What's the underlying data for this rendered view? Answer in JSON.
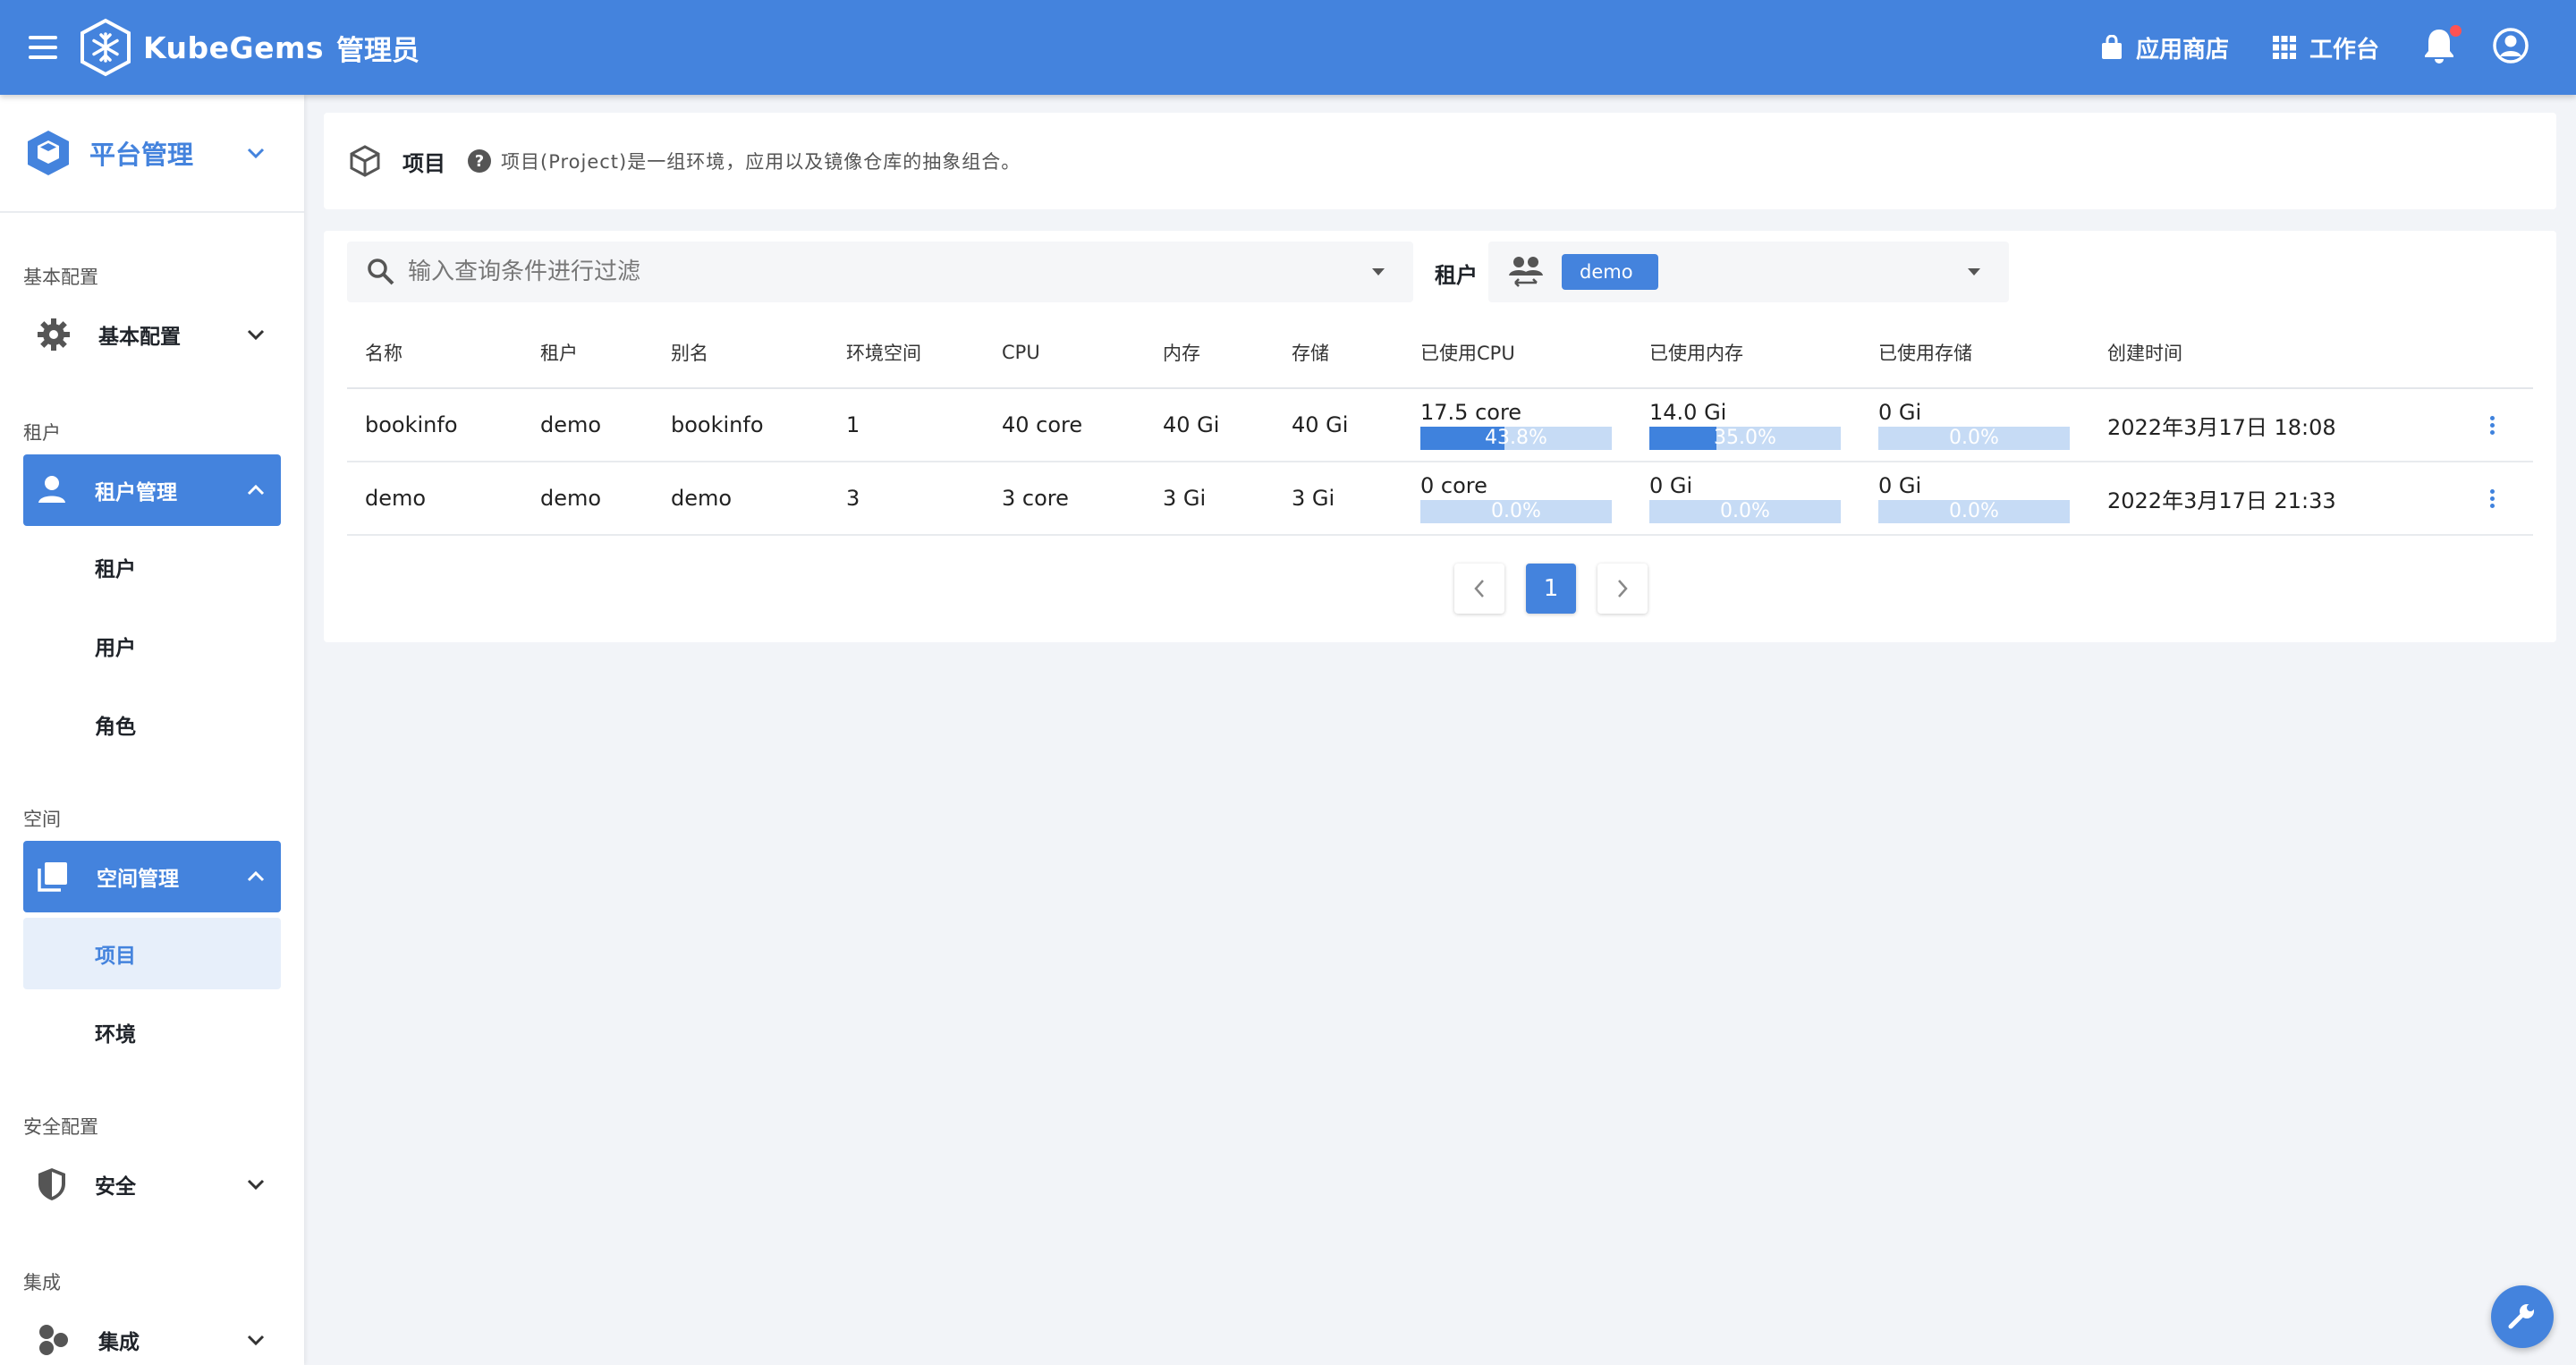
{
  "app": {
    "brand": "KubeGems",
    "role": "管理员"
  },
  "topbar": {
    "app_store": "应用商店",
    "workbench": "工作台"
  },
  "sidebar": {
    "platform": "平台管理",
    "sections": {
      "basic": {
        "title": "基本配置",
        "group": "基本配置"
      },
      "tenant": {
        "title": "租户",
        "group": "租户管理",
        "items": [
          "租户",
          "用户",
          "角色"
        ]
      },
      "space": {
        "title": "空间",
        "group": "空间管理",
        "items": [
          "项目",
          "环境"
        ]
      },
      "security": {
        "title": "安全配置",
        "group": "安全"
      },
      "integration": {
        "title": "集成",
        "group": "集成"
      }
    }
  },
  "header": {
    "title": "项目",
    "description": "项目(Project)是一组环境，应用以及镜像仓库的抽象组合。"
  },
  "filter": {
    "placeholder": "输入查询条件进行过滤",
    "tenant_label": "租户",
    "tenant_value": "demo"
  },
  "table": {
    "headers": [
      "名称",
      "租户",
      "别名",
      "环境空间",
      "CPU",
      "内存",
      "存储",
      "已使用CPU",
      "已使用内存",
      "已使用存储",
      "创建时间"
    ],
    "rows": [
      {
        "name": "bookinfo",
        "tenant": "demo",
        "alias": "bookinfo",
        "envs": "1",
        "cpu": "40 core",
        "memory": "40 Gi",
        "storage": "40 Gi",
        "used_cpu": "17.5 core",
        "used_cpu_pct": "43.8%",
        "used_cpu_frac": 0.438,
        "used_mem": "14.0 Gi",
        "used_mem_pct": "35.0%",
        "used_mem_frac": 0.35,
        "used_storage": "0 Gi",
        "used_storage_pct": "0.0%",
        "used_storage_frac": 0.0,
        "created": "2022年3月17日 18:08"
      },
      {
        "name": "demo",
        "tenant": "demo",
        "alias": "demo",
        "envs": "3",
        "cpu": "3 core",
        "memory": "3 Gi",
        "storage": "3 Gi",
        "used_cpu": "0 core",
        "used_cpu_pct": "0.0%",
        "used_cpu_frac": 0.0,
        "used_mem": "0 Gi",
        "used_mem_pct": "0.0%",
        "used_mem_frac": 0.0,
        "used_storage": "0 Gi",
        "used_storage_pct": "0.0%",
        "used_storage_frac": 0.0,
        "created": "2022年3月17日 21:33"
      }
    ]
  },
  "pagination": {
    "current": "1"
  },
  "colors": {
    "primary": "#4483dd",
    "bar_track": "#c6dbf5",
    "bar_fill": "#3f82dd",
    "notify": "#ff5252"
  }
}
